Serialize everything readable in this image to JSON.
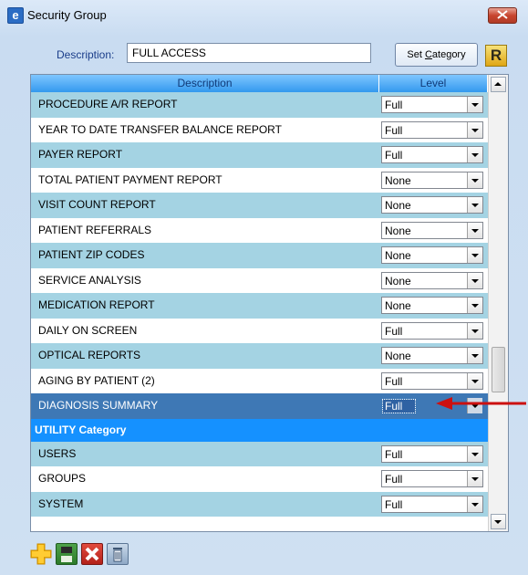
{
  "window": {
    "title": "Security Group"
  },
  "form": {
    "description_label": "Description:",
    "description_value": "FULL ACCESS",
    "set_category_prefix": "Set ",
    "set_category_accel": "C",
    "set_category_suffix": "ategory",
    "r_icon_text": "R"
  },
  "grid": {
    "headers": {
      "description": "Description",
      "level": "Level"
    },
    "rows": [
      {
        "description": "PROCEDURE A/R REPORT",
        "level": "Full"
      },
      {
        "description": "YEAR TO DATE TRANSFER BALANCE REPORT",
        "level": "Full"
      },
      {
        "description": "PAYER REPORT",
        "level": "Full"
      },
      {
        "description": "TOTAL PATIENT PAYMENT REPORT",
        "level": "None"
      },
      {
        "description": "VISIT COUNT REPORT",
        "level": "None"
      },
      {
        "description": "PATIENT REFERRALS",
        "level": "None"
      },
      {
        "description": "PATIENT ZIP CODES",
        "level": "None"
      },
      {
        "description": "SERVICE ANALYSIS",
        "level": "None"
      },
      {
        "description": "MEDICATION REPORT",
        "level": "None"
      },
      {
        "description": "DAILY ON SCREEN",
        "level": "Full"
      },
      {
        "description": "OPTICAL REPORTS",
        "level": "None"
      },
      {
        "description": "AGING BY PATIENT (2)",
        "level": "Full"
      },
      {
        "description": "DIAGNOSIS SUMMARY",
        "level": "Full",
        "selected": true
      }
    ],
    "category": "UTILITY Category",
    "category_rows": [
      {
        "description": "USERS",
        "level": "Full"
      },
      {
        "description": "GROUPS",
        "level": "Full"
      },
      {
        "description": "SYSTEM",
        "level": "Full"
      }
    ]
  },
  "colors": {
    "row_alt": "#a4d3e3",
    "selected": "#3e78b5",
    "category": "#1591ff",
    "annotation_arrow": "#cc1010"
  },
  "icons": {
    "add": "plus-icon",
    "save": "floppy-disk-icon",
    "delete": "x-icon",
    "trash": "trash-can-icon"
  }
}
